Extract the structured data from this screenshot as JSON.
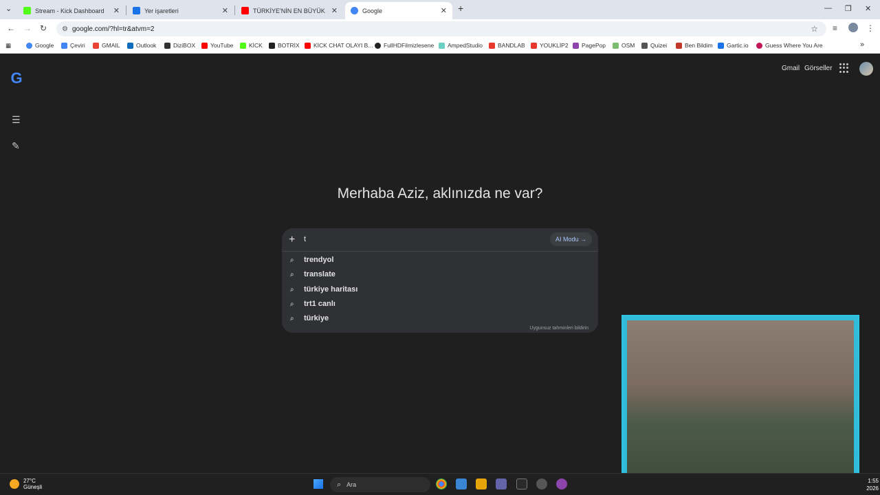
{
  "tabs": [
    {
      "label": "Stream - Kick Dashboard",
      "color": "#53fc18"
    },
    {
      "label": "Yer işaretleri",
      "color": "#1a73e8"
    },
    {
      "label": "TÜRKİYE'NİN EN BÜYÜK KUMA",
      "color": "#ff0000"
    },
    {
      "label": "Google",
      "color": "#4285f4"
    }
  ],
  "new_tab": "+",
  "address": "google.com/?hl=tr&atvm=2",
  "bookmarks": [
    {
      "label": "Google",
      "color": "#4285f4"
    },
    {
      "label": "Çeviri",
      "color": "#4285f4"
    },
    {
      "label": "GMAIL",
      "color": "#ea4335"
    },
    {
      "label": "Outlook",
      "color": "#0f6cbd"
    },
    {
      "label": "DiziBOX",
      "color": "#333333"
    },
    {
      "label": "YouTube",
      "color": "#ff0000"
    },
    {
      "label": "KİCK",
      "color": "#53fc18"
    },
    {
      "label": "BOTRİX",
      "color": "#222222"
    },
    {
      "label": "KİCK CHAT OLAYI B...",
      "color": "#ff0000"
    },
    {
      "label": "FullHDFilmizlesene",
      "color": "#222222"
    },
    {
      "label": "AmpedStudio",
      "color": "#6ad0c2"
    },
    {
      "label": "BANDLAB",
      "color": "#e8382b"
    },
    {
      "label": "YOUKLİP2",
      "color": "#e8382b"
    },
    {
      "label": "PagePop",
      "color": "#8e44ad"
    },
    {
      "label": "OSM",
      "color": "#7ebc6f"
    },
    {
      "label": "Quizei",
      "color": "#555555"
    },
    {
      "label": "Ben Bildim",
      "color": "#c0392b"
    },
    {
      "label": "Gartic.io",
      "color": "#1a73e8"
    },
    {
      "label": "Guess Where You Are",
      "color": "#c2185b"
    }
  ],
  "header": {
    "gmail": "Gmail",
    "images": "Görseller"
  },
  "greeting": "Merhaba Aziz, aklınızda ne var?",
  "search": {
    "plus": "+",
    "query": "t",
    "ai_mode": "AI Modu →",
    "suggestions": [
      "trendyol",
      "translate",
      "türkiye haritası",
      "trt1 canlı",
      "türkiye"
    ],
    "report": "Uygunsuz tahminleri bildirin"
  },
  "taskbar": {
    "temp": "27°C",
    "condition": "Güneşli",
    "search_placeholder": "Ara",
    "time": "1:55",
    "date": "2026"
  }
}
